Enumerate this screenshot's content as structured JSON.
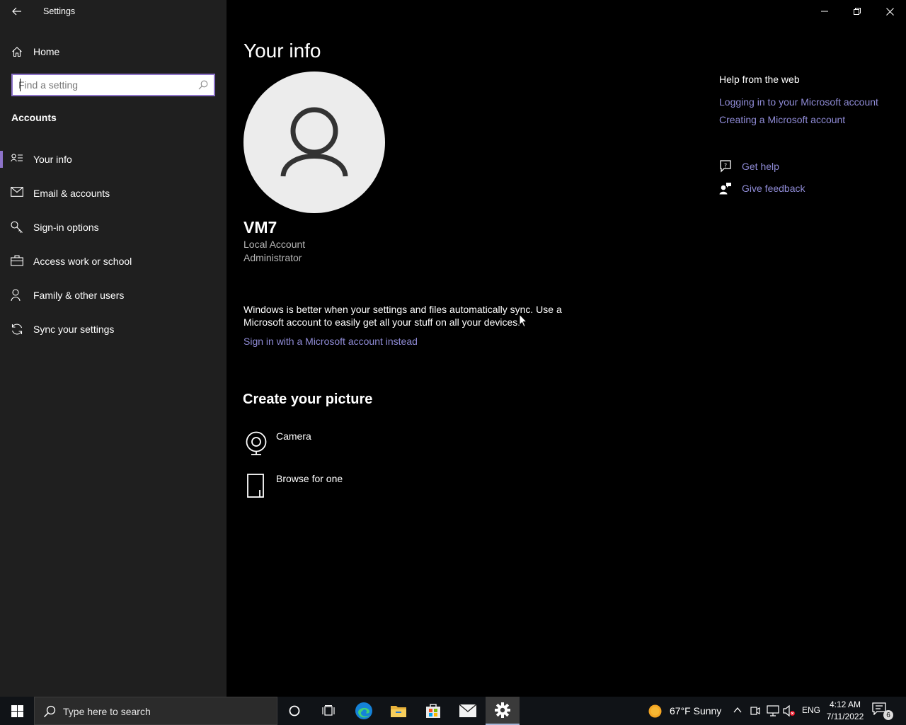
{
  "window": {
    "title": "Settings"
  },
  "sidebar": {
    "home_label": "Home",
    "search_placeholder": "Find a setting",
    "section": "Accounts",
    "items": [
      {
        "label": "Your info",
        "icon": "contact-info-icon",
        "selected": true
      },
      {
        "label": "Email & accounts",
        "icon": "mail-icon",
        "selected": false
      },
      {
        "label": "Sign-in options",
        "icon": "key-icon",
        "selected": false
      },
      {
        "label": "Access work or school",
        "icon": "briefcase-icon",
        "selected": false
      },
      {
        "label": "Family & other users",
        "icon": "person-add-icon",
        "selected": false
      },
      {
        "label": "Sync your settings",
        "icon": "sync-icon",
        "selected": false
      }
    ]
  },
  "main": {
    "title": "Your info",
    "user_name": "VM7",
    "account_type": "Local Account",
    "account_role": "Administrator",
    "sync_message": "Windows is better when your settings and files automatically sync. Use a Microsoft account to easily get all your stuff on all your devices.",
    "ms_account_link": "Sign in with a Microsoft account instead",
    "create_picture_heading": "Create your picture",
    "picture_options": [
      {
        "label": "Camera",
        "icon": "camera-icon"
      },
      {
        "label": "Browse for one",
        "icon": "file-icon"
      }
    ]
  },
  "help": {
    "heading": "Help from the web",
    "links": [
      "Logging in to your Microsoft account",
      "Creating a Microsoft account"
    ],
    "get_help": "Get help",
    "give_feedback": "Give feedback"
  },
  "taskbar": {
    "search_placeholder": "Type here to search",
    "weather": "67°F  Sunny",
    "language": "ENG",
    "time": "4:12 AM",
    "date": "7/11/2022",
    "notification_count": "6"
  },
  "colors": {
    "accent": "#8d73c9",
    "link": "#8f8bd6",
    "sidebar_bg": "#1f1f1f",
    "main_bg": "#000000"
  }
}
